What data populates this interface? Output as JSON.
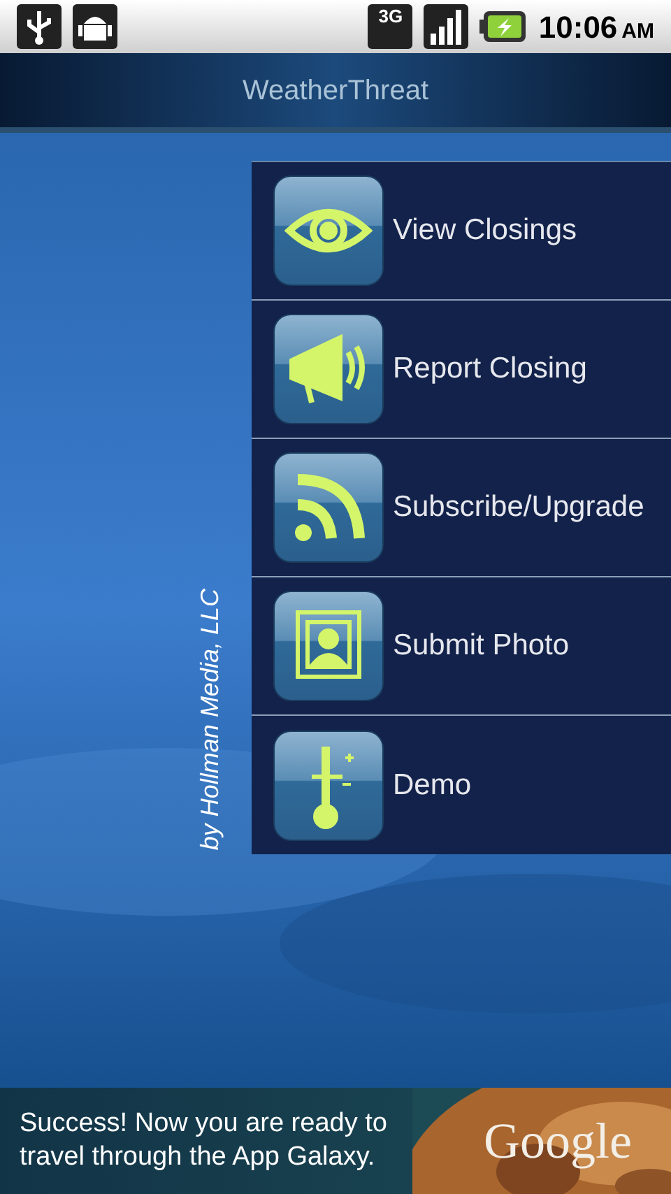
{
  "status_bar": {
    "network": "3G",
    "time": "10:06",
    "meridiem": "AM"
  },
  "title_bar": {
    "title": "WeatherThreat"
  },
  "credit": "by Hollman Media, LLC",
  "menu": [
    {
      "label": "View Closings"
    },
    {
      "label": "Report Closing"
    },
    {
      "label": "Subscribe/Upgrade"
    },
    {
      "label": "Submit Photo"
    },
    {
      "label": "Demo"
    }
  ],
  "ad": {
    "text": "Success! Now you are ready to travel through the App Galaxy.",
    "brand": "Google"
  }
}
